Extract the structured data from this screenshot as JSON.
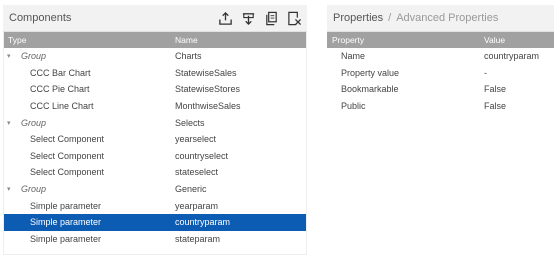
{
  "components_panel": {
    "title": "Components",
    "toolbar": {
      "icons": [
        "move-up-icon",
        "move-down-icon",
        "duplicate-icon",
        "delete-icon"
      ]
    },
    "columns": {
      "type": "Type",
      "name": "Name"
    },
    "rows": [
      {
        "kind": "group",
        "type": "Group",
        "name": "Charts"
      },
      {
        "kind": "child",
        "type": "CCC Bar Chart",
        "name": "StatewiseSales"
      },
      {
        "kind": "child",
        "type": "CCC Pie Chart",
        "name": "StatewiseStores"
      },
      {
        "kind": "child",
        "type": "CCC Line Chart",
        "name": "MonthwiseSales"
      },
      {
        "kind": "group",
        "type": "Group",
        "name": "Selects"
      },
      {
        "kind": "child",
        "type": "Select Component",
        "name": "yearselect"
      },
      {
        "kind": "child",
        "type": "Select Component",
        "name": "countryselect"
      },
      {
        "kind": "child",
        "type": "Select Component",
        "name": "stateselect"
      },
      {
        "kind": "group",
        "type": "Group",
        "name": "Generic"
      },
      {
        "kind": "child",
        "type": "Simple parameter",
        "name": "yearparam"
      },
      {
        "kind": "child",
        "type": "Simple parameter",
        "name": "countryparam",
        "selected": true
      },
      {
        "kind": "child",
        "type": "Simple parameter",
        "name": "stateparam"
      }
    ]
  },
  "properties_panel": {
    "title": "Properties",
    "separator": "/",
    "subtitle": "Advanced Properties",
    "columns": {
      "property": "Property",
      "value": "Value"
    },
    "rows": [
      {
        "property": "Name",
        "value": "countryparam"
      },
      {
        "property": "Property value",
        "value": "-"
      },
      {
        "property": "Bookmarkable",
        "value": "False"
      },
      {
        "property": "Public",
        "value": "False"
      }
    ]
  },
  "colors": {
    "selected_row": "#0d5cb4",
    "column_header": "#a1a1a1",
    "panel_header": "#f2f2f2"
  }
}
